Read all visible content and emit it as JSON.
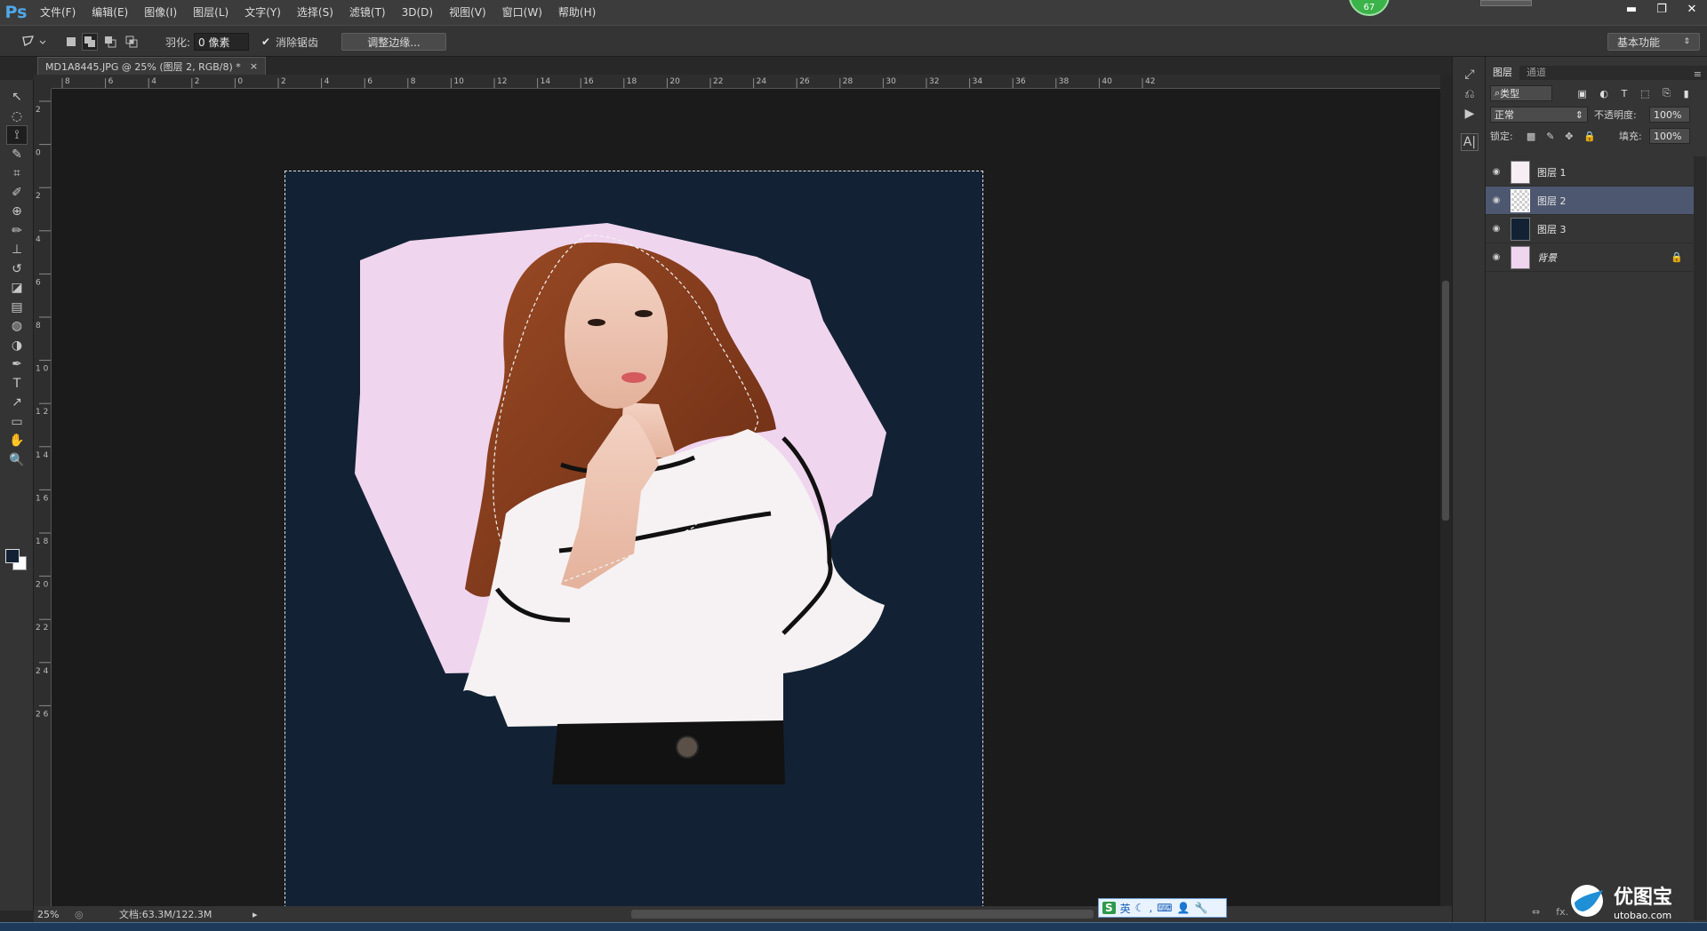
{
  "app": {
    "logo": "Ps"
  },
  "menu": [
    "文件(F)",
    "编辑(E)",
    "图像(I)",
    "图层(L)",
    "文字(Y)",
    "选择(S)",
    "滤镜(T)",
    "3D(D)",
    "视图(V)",
    "窗口(W)",
    "帮助(H)"
  ],
  "badge": {
    "value": "67",
    "color": "#3bb34a"
  },
  "window_controls": {
    "minimize": "▬",
    "restore": "❐",
    "close": "✕"
  },
  "options_bar": {
    "feather_label": "羽化:",
    "feather_value": "0 像素",
    "antialias_label": "消除锯齿",
    "antialias_checked": true,
    "refine_edge_button": "调整边缘...",
    "workspace": "基本功能"
  },
  "document": {
    "tab_title": "MD1A8445.JPG @ 25% (图层 2, RGB/8) *",
    "tab_close": "×",
    "canvas_color": "#122234",
    "zoom": "25%",
    "doc_size": "文档:63.3M/122.3M"
  },
  "ruler_top_labels": [
    "8",
    "6",
    "4",
    "2",
    "0",
    "2",
    "4",
    "6",
    "8",
    "10",
    "12",
    "14",
    "16",
    "18",
    "20",
    "22",
    "24",
    "26",
    "28",
    "30",
    "32",
    "34",
    "36",
    "38",
    "40",
    "42"
  ],
  "ruler_left_labels": [
    "2",
    "0",
    "2",
    "4",
    "6",
    "8",
    "1 0",
    "1 2",
    "1 4",
    "1 6",
    "1 8",
    "2 0",
    "2 2",
    "2 4",
    "2 6"
  ],
  "tools": [
    "move-icon",
    "marquee-icon",
    "polygonal-lasso-icon",
    "quick-select-icon",
    "crop-icon",
    "eyedropper-icon",
    "spot-heal-icon",
    "brush-icon",
    "clone-stamp-icon",
    "history-brush-icon",
    "eraser-icon",
    "gradient-icon",
    "blur-icon",
    "dodge-icon",
    "pen-icon",
    "type-icon",
    "path-select-icon",
    "rectangle-icon",
    "hand-icon",
    "zoom-icon"
  ],
  "layers_panel": {
    "tabs": [
      "图层",
      "通道"
    ],
    "filter_kind": "类型",
    "blend_mode": "正常",
    "opacity_label": "不透明度:",
    "opacity_value": "100%",
    "lock_label": "锁定:",
    "fill_label": "填充:",
    "fill_value": "100%",
    "layers": [
      {
        "name": "图层 1",
        "selected": false,
        "locked": false,
        "thumb": "person"
      },
      {
        "name": "图层 2",
        "selected": true,
        "locked": false,
        "thumb": "person-transparent"
      },
      {
        "name": "图层 3",
        "selected": false,
        "locked": false,
        "thumb": "navy"
      },
      {
        "name": "背景",
        "selected": false,
        "locked": true,
        "thumb": "person-pink"
      }
    ],
    "footer_icons": [
      "link-icon",
      "fx-icon"
    ]
  },
  "ime": {
    "label": "英"
  },
  "watermark": {
    "text": "优图宝",
    "url": "utobao.com"
  }
}
